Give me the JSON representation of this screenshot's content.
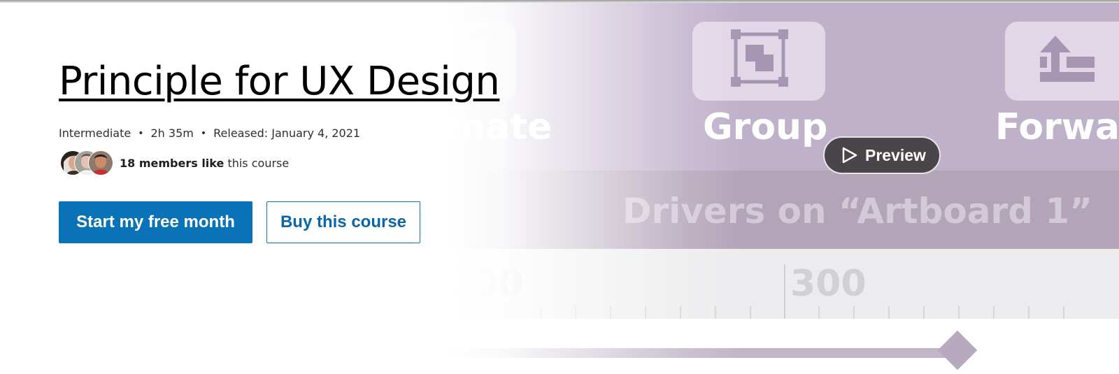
{
  "course": {
    "title": "Principle for UX Design",
    "level": "Intermediate",
    "duration": "2h 35m",
    "released": "Released: January 4, 2021",
    "separator": "•"
  },
  "members": {
    "count_text": "18 members like",
    "suffix_text": " this course"
  },
  "actions": {
    "primary_label": "Start my free month",
    "secondary_label": "Buy this course"
  },
  "preview": {
    "button_label": "Preview",
    "labels": {
      "left": "mate",
      "mid": "Group",
      "right": "Forwa",
      "drivers": "Drivers on “Artboard 1”",
      "ruler_a": "200",
      "ruler_b": "300"
    },
    "tile_icons": [
      "animate-icon",
      "group-icon",
      "bring-forward-icon"
    ]
  },
  "colors": {
    "primary": "#0a73b7",
    "preview_purple": "#c0b1cb",
    "text": "#2f2f2f"
  }
}
